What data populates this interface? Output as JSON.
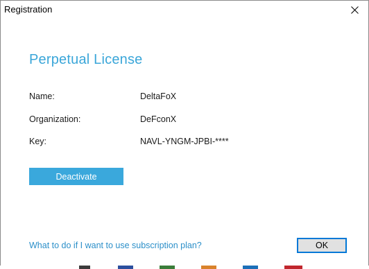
{
  "window": {
    "title": "Registration"
  },
  "license": {
    "heading": "Perpetual License",
    "fields": [
      {
        "label": "Name:",
        "value": "DeltaFoX"
      },
      {
        "label": "Organization:",
        "value": "DeFconX"
      },
      {
        "label": "Key:",
        "value": "NAVL-YNGM-JPBI-****"
      }
    ]
  },
  "actions": {
    "deactivate_label": "Deactivate",
    "subscription_link": "What to do if I want to use subscription plan?",
    "ok_label": "OK"
  },
  "colors": {
    "accent": "#3aa8dc",
    "link": "#2b8fc9",
    "heading": "#3aa6d9"
  },
  "icons": {
    "close": "close-icon"
  }
}
